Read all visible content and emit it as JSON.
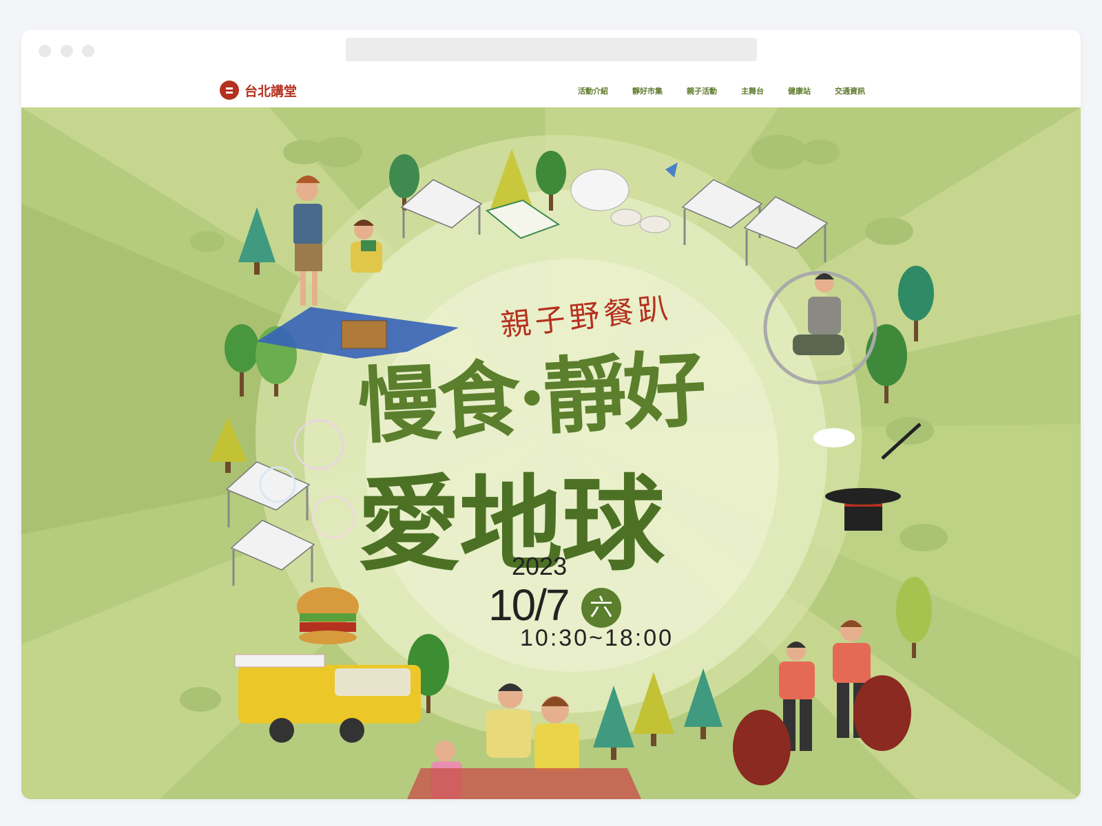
{
  "logo": {
    "text": "台北講堂"
  },
  "nav": {
    "items": [
      "活動介紹",
      "靜好市集",
      "親子活動",
      "主舞台",
      "健康站",
      "交通資訊"
    ]
  },
  "hero": {
    "subtitle": "親子野餐趴",
    "title_line1": "慢食·靜好",
    "title_line2": "愛地球",
    "year": "2023",
    "date": "10/7",
    "weekday": "六",
    "time": "10:30~18:00"
  },
  "colors": {
    "accent": "#b5311f",
    "green": "#5b7f2c",
    "nav_green": "#5d7a2b"
  }
}
